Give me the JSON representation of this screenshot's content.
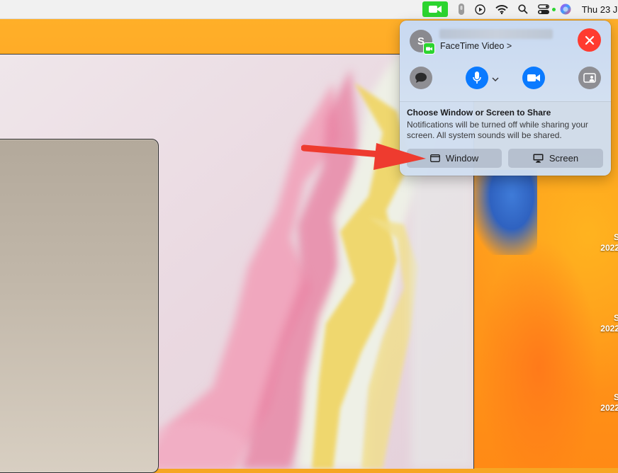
{
  "menubar": {
    "clock": "Thu 23 J",
    "icons": [
      "facetime-video-icon",
      "microphone-indicator-icon",
      "play-icon",
      "wifi-icon",
      "search-icon",
      "control-center-icon",
      "siri-icon"
    ]
  },
  "facetime_panel": {
    "avatar_initial": "S",
    "subtitle": "FaceTime Video",
    "chevron": ">",
    "share": {
      "title": "Choose Window or Screen to Share",
      "description": "Notifications will be turned off while sharing your screen. All system sounds will be shared.",
      "window_button": "Window",
      "screen_button": "Screen"
    }
  },
  "desktop_labels": [
    {
      "line1": "S",
      "line2": "2022"
    },
    {
      "line1": "S",
      "line2": "2022"
    },
    {
      "line1": "S",
      "line2": "2022"
    }
  ],
  "colors": {
    "facetime_green": "#2bd42f",
    "end_call_red": "#ff3b30",
    "active_blue": "#0a7aff",
    "annotation_red": "#ee3b2f"
  }
}
